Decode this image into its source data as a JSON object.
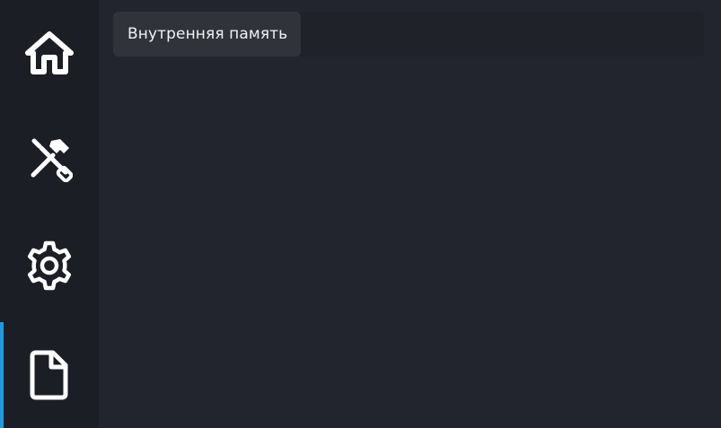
{
  "sidebar": {
    "items": [
      {
        "icon": "home-icon",
        "active": false
      },
      {
        "icon": "tools-icon",
        "active": false
      },
      {
        "icon": "gear-icon",
        "active": false
      },
      {
        "icon": "file-icon",
        "active": true
      }
    ],
    "active_color": "#1e9be0"
  },
  "header": {
    "tabs": [
      {
        "label": "Внутренняя память"
      }
    ]
  }
}
